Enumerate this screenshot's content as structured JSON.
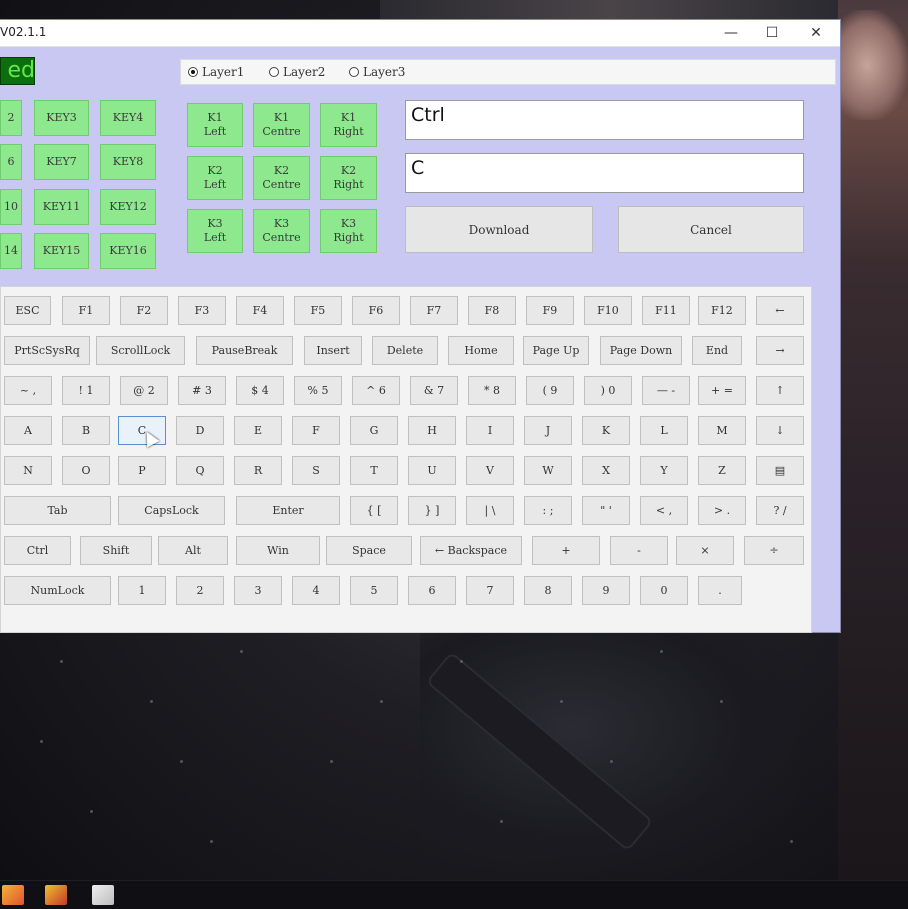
{
  "window": {
    "title": "V02.1.1",
    "controls": {
      "minimize": "—",
      "maximize": "☐",
      "close": "✕"
    }
  },
  "status": {
    "text": "ed",
    "color": "#0c6e0c"
  },
  "layers": [
    {
      "label": "Layer1",
      "selected": true
    },
    {
      "label": "Layer2",
      "selected": false
    },
    {
      "label": "Layer3",
      "selected": false
    }
  ],
  "macro_keys": [
    [
      "2",
      "KEY3",
      "KEY4"
    ],
    [
      "6",
      "KEY7",
      "KEY8"
    ],
    [
      "10",
      "KEY11",
      "KEY12"
    ],
    [
      "14",
      "KEY15",
      "KEY16"
    ]
  ],
  "knobs": [
    [
      "K1\nLeft",
      "K1\nCentre",
      "K1\nRight"
    ],
    [
      "K2\nLeft",
      "K2\nCentre",
      "K2\nRight"
    ],
    [
      "K3\nLeft",
      "K3\nCentre",
      "K3\nRight"
    ]
  ],
  "fields": {
    "modifier": "Ctrl",
    "key": "C"
  },
  "actions": {
    "download": "Download",
    "cancel": "Cancel"
  },
  "keyboard_rows": [
    [
      "ESC",
      "F1",
      "F2",
      "F3",
      "F4",
      "F5",
      "F6",
      "F7",
      "F8",
      "F9",
      "F10",
      "F11",
      "F12",
      "←"
    ],
    [
      "PrtScSysRq",
      "ScrollLock",
      "PauseBreak",
      "Insert",
      "Delete",
      "Home",
      "Page Up",
      "Page Down",
      "End",
      "→"
    ],
    [
      "~ ,",
      "! 1",
      "@ 2",
      "# 3",
      "$ 4",
      "% 5",
      "^ 6",
      "& 7",
      "* 8",
      "( 9",
      ") 0",
      "— -",
      "+ =",
      "↑"
    ],
    [
      "A",
      "B",
      "C",
      "D",
      "E",
      "F",
      "G",
      "H",
      "I",
      "J",
      "K",
      "L",
      "M",
      "↓"
    ],
    [
      "N",
      "O",
      "P",
      "Q",
      "R",
      "S",
      "T",
      "U",
      "V",
      "W",
      "X",
      "Y",
      "Z",
      "▤"
    ],
    [
      "Tab",
      "CapsLock",
      "Enter",
      "{ [",
      "} ]",
      "| \\",
      ": ;",
      "\" '",
      "< ,",
      "> .",
      "? /"
    ],
    [
      "Ctrl",
      "Shift",
      "Alt",
      "Win",
      "Space",
      "← Backspace",
      "+",
      "-",
      "×",
      "÷"
    ],
    [
      "NumLock",
      "1",
      "2",
      "3",
      "4",
      "5",
      "6",
      "7",
      "8",
      "9",
      "0",
      "."
    ]
  ],
  "selected_key": "C"
}
